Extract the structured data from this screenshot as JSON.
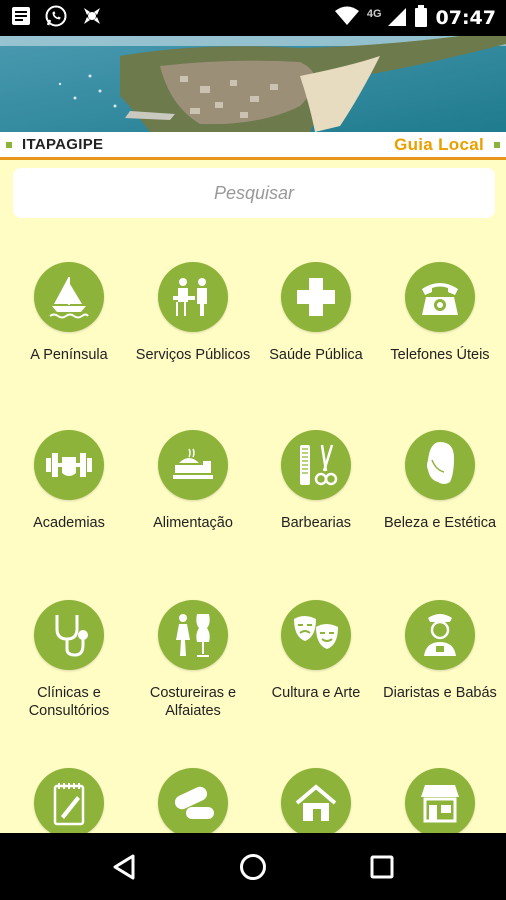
{
  "status_bar": {
    "time": "07:47",
    "network": "4G",
    "icons": [
      "message-icon",
      "whatsapp-icon",
      "app-icon",
      "wifi-icon",
      "signal-icon",
      "battery-icon"
    ]
  },
  "header": {
    "place": "ITAPAGIPE",
    "brand": "Guia Local",
    "accent": "#e8951c",
    "brand_color": "#e8a000"
  },
  "search": {
    "placeholder": "Pesquisar"
  },
  "theme": {
    "background": "#fffcc4",
    "icon_green": "#8db33a"
  },
  "categories": [
    {
      "label": "A Península",
      "icon": "sailboat-icon"
    },
    {
      "label": "Serviços Públicos",
      "icon": "public-services-icon"
    },
    {
      "label": "Saúde Pública",
      "icon": "health-cross-icon"
    },
    {
      "label": "Telefones Úteis",
      "icon": "telephone-icon"
    },
    {
      "label": "Academias",
      "icon": "dumbbell-icon"
    },
    {
      "label": "Alimentação",
      "icon": "food-icon"
    },
    {
      "label": "Barbearias",
      "icon": "comb-scissors-icon"
    },
    {
      "label": "Beleza e Estética",
      "icon": "woman-profile-icon"
    },
    {
      "label": "Clínicas e Consultórios",
      "icon": "stethoscope-icon"
    },
    {
      "label": "Costureiras e Alfaiates",
      "icon": "mannequin-icon"
    },
    {
      "label": "Cultura e Arte",
      "icon": "theater-masks-icon"
    },
    {
      "label": "Diaristas e Babás",
      "icon": "maid-icon"
    },
    {
      "label": "",
      "icon": "notepad-icon"
    },
    {
      "label": "",
      "icon": "pills-icon"
    },
    {
      "label": "",
      "icon": "house-icon"
    },
    {
      "label": "",
      "icon": "store-icon"
    }
  ],
  "nav": {
    "icons": [
      "back-icon",
      "home-icon",
      "recents-icon"
    ]
  }
}
